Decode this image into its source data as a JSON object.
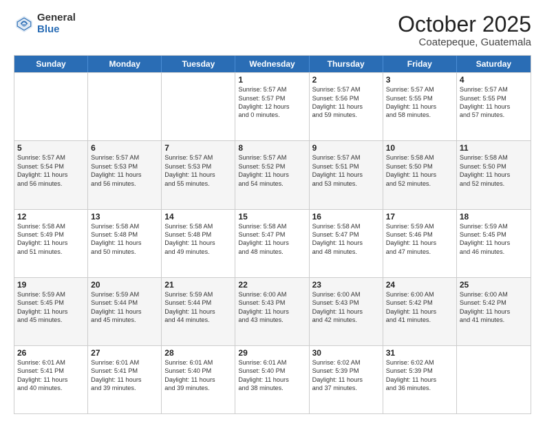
{
  "logo": {
    "general": "General",
    "blue": "Blue"
  },
  "title": "October 2025",
  "location": "Coatepeque, Guatemala",
  "days_of_week": [
    "Sunday",
    "Monday",
    "Tuesday",
    "Wednesday",
    "Thursday",
    "Friday",
    "Saturday"
  ],
  "weeks": [
    [
      {
        "day": "",
        "lines": []
      },
      {
        "day": "",
        "lines": []
      },
      {
        "day": "",
        "lines": []
      },
      {
        "day": "1",
        "lines": [
          "Sunrise: 5:57 AM",
          "Sunset: 5:57 PM",
          "Daylight: 12 hours",
          "and 0 minutes."
        ]
      },
      {
        "day": "2",
        "lines": [
          "Sunrise: 5:57 AM",
          "Sunset: 5:56 PM",
          "Daylight: 11 hours",
          "and 59 minutes."
        ]
      },
      {
        "day": "3",
        "lines": [
          "Sunrise: 5:57 AM",
          "Sunset: 5:55 PM",
          "Daylight: 11 hours",
          "and 58 minutes."
        ]
      },
      {
        "day": "4",
        "lines": [
          "Sunrise: 5:57 AM",
          "Sunset: 5:55 PM",
          "Daylight: 11 hours",
          "and 57 minutes."
        ]
      }
    ],
    [
      {
        "day": "5",
        "lines": [
          "Sunrise: 5:57 AM",
          "Sunset: 5:54 PM",
          "Daylight: 11 hours",
          "and 56 minutes."
        ]
      },
      {
        "day": "6",
        "lines": [
          "Sunrise: 5:57 AM",
          "Sunset: 5:53 PM",
          "Daylight: 11 hours",
          "and 56 minutes."
        ]
      },
      {
        "day": "7",
        "lines": [
          "Sunrise: 5:57 AM",
          "Sunset: 5:53 PM",
          "Daylight: 11 hours",
          "and 55 minutes."
        ]
      },
      {
        "day": "8",
        "lines": [
          "Sunrise: 5:57 AM",
          "Sunset: 5:52 PM",
          "Daylight: 11 hours",
          "and 54 minutes."
        ]
      },
      {
        "day": "9",
        "lines": [
          "Sunrise: 5:57 AM",
          "Sunset: 5:51 PM",
          "Daylight: 11 hours",
          "and 53 minutes."
        ]
      },
      {
        "day": "10",
        "lines": [
          "Sunrise: 5:58 AM",
          "Sunset: 5:50 PM",
          "Daylight: 11 hours",
          "and 52 minutes."
        ]
      },
      {
        "day": "11",
        "lines": [
          "Sunrise: 5:58 AM",
          "Sunset: 5:50 PM",
          "Daylight: 11 hours",
          "and 52 minutes."
        ]
      }
    ],
    [
      {
        "day": "12",
        "lines": [
          "Sunrise: 5:58 AM",
          "Sunset: 5:49 PM",
          "Daylight: 11 hours",
          "and 51 minutes."
        ]
      },
      {
        "day": "13",
        "lines": [
          "Sunrise: 5:58 AM",
          "Sunset: 5:48 PM",
          "Daylight: 11 hours",
          "and 50 minutes."
        ]
      },
      {
        "day": "14",
        "lines": [
          "Sunrise: 5:58 AM",
          "Sunset: 5:48 PM",
          "Daylight: 11 hours",
          "and 49 minutes."
        ]
      },
      {
        "day": "15",
        "lines": [
          "Sunrise: 5:58 AM",
          "Sunset: 5:47 PM",
          "Daylight: 11 hours",
          "and 48 minutes."
        ]
      },
      {
        "day": "16",
        "lines": [
          "Sunrise: 5:58 AM",
          "Sunset: 5:47 PM",
          "Daylight: 11 hours",
          "and 48 minutes."
        ]
      },
      {
        "day": "17",
        "lines": [
          "Sunrise: 5:59 AM",
          "Sunset: 5:46 PM",
          "Daylight: 11 hours",
          "and 47 minutes."
        ]
      },
      {
        "day": "18",
        "lines": [
          "Sunrise: 5:59 AM",
          "Sunset: 5:45 PM",
          "Daylight: 11 hours",
          "and 46 minutes."
        ]
      }
    ],
    [
      {
        "day": "19",
        "lines": [
          "Sunrise: 5:59 AM",
          "Sunset: 5:45 PM",
          "Daylight: 11 hours",
          "and 45 minutes."
        ]
      },
      {
        "day": "20",
        "lines": [
          "Sunrise: 5:59 AM",
          "Sunset: 5:44 PM",
          "Daylight: 11 hours",
          "and 45 minutes."
        ]
      },
      {
        "day": "21",
        "lines": [
          "Sunrise: 5:59 AM",
          "Sunset: 5:44 PM",
          "Daylight: 11 hours",
          "and 44 minutes."
        ]
      },
      {
        "day": "22",
        "lines": [
          "Sunrise: 6:00 AM",
          "Sunset: 5:43 PM",
          "Daylight: 11 hours",
          "and 43 minutes."
        ]
      },
      {
        "day": "23",
        "lines": [
          "Sunrise: 6:00 AM",
          "Sunset: 5:43 PM",
          "Daylight: 11 hours",
          "and 42 minutes."
        ]
      },
      {
        "day": "24",
        "lines": [
          "Sunrise: 6:00 AM",
          "Sunset: 5:42 PM",
          "Daylight: 11 hours",
          "and 41 minutes."
        ]
      },
      {
        "day": "25",
        "lines": [
          "Sunrise: 6:00 AM",
          "Sunset: 5:42 PM",
          "Daylight: 11 hours",
          "and 41 minutes."
        ]
      }
    ],
    [
      {
        "day": "26",
        "lines": [
          "Sunrise: 6:01 AM",
          "Sunset: 5:41 PM",
          "Daylight: 11 hours",
          "and 40 minutes."
        ]
      },
      {
        "day": "27",
        "lines": [
          "Sunrise: 6:01 AM",
          "Sunset: 5:41 PM",
          "Daylight: 11 hours",
          "and 39 minutes."
        ]
      },
      {
        "day": "28",
        "lines": [
          "Sunrise: 6:01 AM",
          "Sunset: 5:40 PM",
          "Daylight: 11 hours",
          "and 39 minutes."
        ]
      },
      {
        "day": "29",
        "lines": [
          "Sunrise: 6:01 AM",
          "Sunset: 5:40 PM",
          "Daylight: 11 hours",
          "and 38 minutes."
        ]
      },
      {
        "day": "30",
        "lines": [
          "Sunrise: 6:02 AM",
          "Sunset: 5:39 PM",
          "Daylight: 11 hours",
          "and 37 minutes."
        ]
      },
      {
        "day": "31",
        "lines": [
          "Sunrise: 6:02 AM",
          "Sunset: 5:39 PM",
          "Daylight: 11 hours",
          "and 36 minutes."
        ]
      },
      {
        "day": "",
        "lines": []
      }
    ]
  ]
}
